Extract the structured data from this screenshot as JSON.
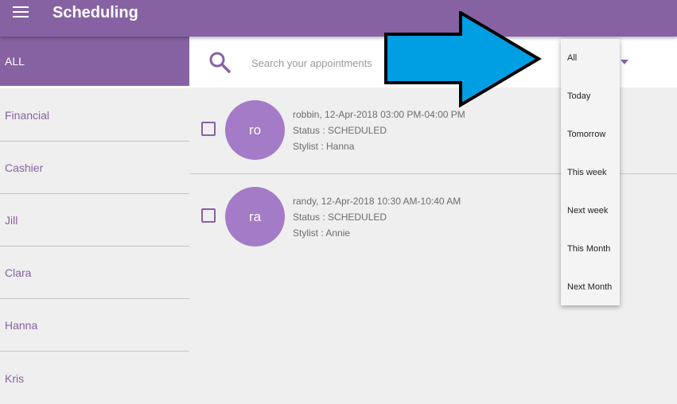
{
  "appbar": {
    "title": "Scheduling",
    "menu_icon": "hamburger-menu-icon"
  },
  "sidebar": {
    "items": [
      {
        "label": "ALL",
        "active": true
      },
      {
        "label": "Financial"
      },
      {
        "label": "Cashier"
      },
      {
        "label": "Jill"
      },
      {
        "label": "Clara"
      },
      {
        "label": "Hanna"
      },
      {
        "label": "Kris"
      }
    ]
  },
  "search": {
    "placeholder": "Search your appointments",
    "icon": "search-icon"
  },
  "appointments": [
    {
      "initials": "ro",
      "header": "robbin, 12-Apr-2018 03:00 PM-04:00 PM",
      "status": "Status : SCHEDULED",
      "stylist": "Stylist : Hanna"
    },
    {
      "initials": "ra",
      "header": "randy, 12-Apr-2018 10:30 AM-10:40 AM",
      "status": "Status : SCHEDULED",
      "stylist": "Stylist : Annie"
    }
  ],
  "filter_dropdown": {
    "options": [
      "All",
      "Today",
      "Tomorrow",
      "This week",
      "Next week",
      "This Month",
      "Next Month"
    ]
  },
  "colors": {
    "primary": "#8762a3",
    "avatar": "#a47bc6",
    "annotation_arrow": "#009fe3"
  }
}
